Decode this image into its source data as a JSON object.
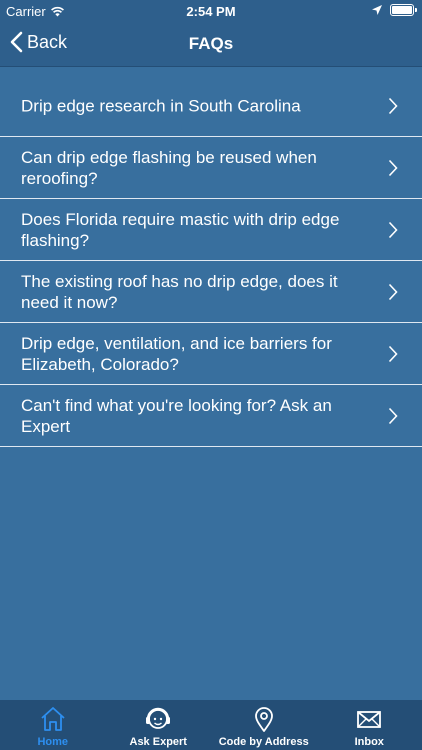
{
  "status_bar": {
    "carrier": "Carrier",
    "time": "2:54 PM"
  },
  "nav": {
    "back_label": "Back",
    "title": "FAQs"
  },
  "faqs": [
    {
      "text": "Drip edge research in South Carolina"
    },
    {
      "text": "Can drip edge flashing be reused when reroofing?"
    },
    {
      "text": "Does Florida require mastic with drip edge flashing?"
    },
    {
      "text": "The existing roof has no drip edge, does it need it now?"
    },
    {
      "text": "Drip edge, ventilation, and ice barriers for Elizabeth, Colorado?"
    },
    {
      "text": "Can't find what you're looking for? Ask an Expert"
    }
  ],
  "tabs": [
    {
      "label": "Home",
      "icon": "home-icon",
      "active": true
    },
    {
      "label": "Ask Expert",
      "icon": "expert-headset-icon",
      "active": false
    },
    {
      "label": "Code by Address",
      "icon": "location-pin-icon",
      "active": false
    },
    {
      "label": "Inbox",
      "icon": "envelope-icon",
      "active": false
    }
  ],
  "colors": {
    "background": "#386f9e",
    "nav": "#2e5f8c",
    "tab_bar": "#244e76",
    "active_tab": "#2d8ff0",
    "separator": "#dfe8f1"
  }
}
